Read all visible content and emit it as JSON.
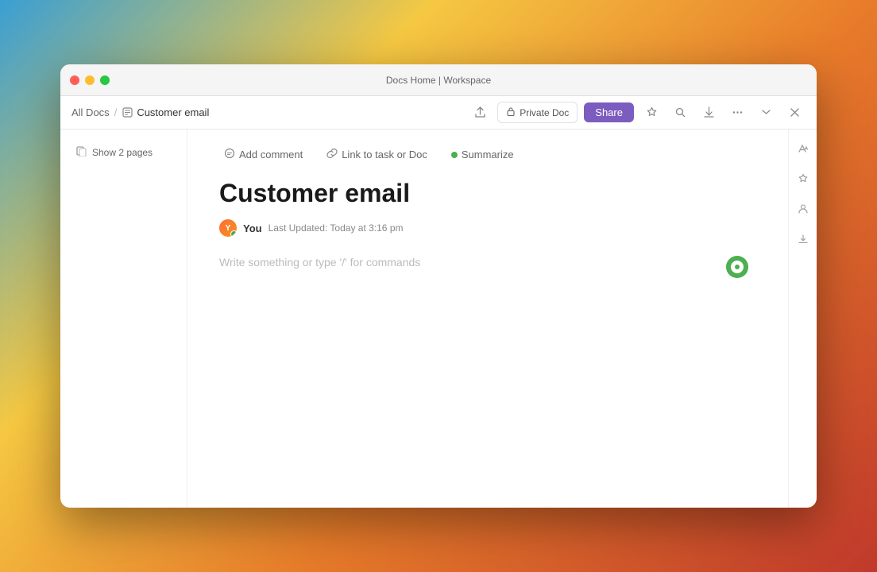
{
  "window": {
    "title": "Docs Home | Workspace"
  },
  "titlebar": {
    "title": "Docs Home | Workspace"
  },
  "toolbar": {
    "breadcrumb": {
      "parent": "All Docs",
      "separator": "/",
      "current": "Customer email"
    },
    "private_doc_label": "Private Doc",
    "share_label": "Share"
  },
  "sidebar": {
    "show_pages_label": "Show 2 pages"
  },
  "doc_toolbar": {
    "add_comment": "Add comment",
    "link_task": "Link to task or Doc",
    "summarize": "Summarize"
  },
  "document": {
    "title": "Customer email",
    "author": "You",
    "updated_label": "Last Updated: Today at 3:16 pm",
    "placeholder": "Write something or type '/' for commands"
  },
  "right_sidebar": {
    "icons": [
      "font-size",
      "star",
      "person",
      "download"
    ]
  }
}
